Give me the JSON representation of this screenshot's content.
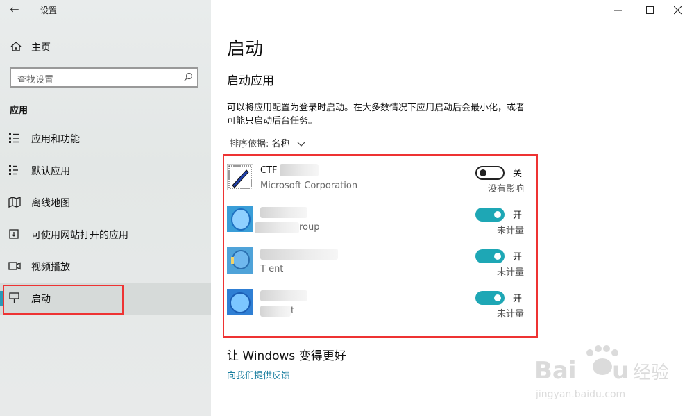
{
  "window": {
    "title": "设置",
    "back_icon": "back-arrow-icon",
    "controls": [
      "minimize-icon",
      "maximize-icon",
      "close-icon"
    ]
  },
  "sidebar": {
    "home_label": "主页",
    "search_placeholder": "查找设置",
    "section_label": "应用",
    "items": [
      {
        "label": "应用和功能",
        "icon": "apps-features-icon"
      },
      {
        "label": "默认应用",
        "icon": "default-apps-icon"
      },
      {
        "label": "离线地图",
        "icon": "offline-maps-icon"
      },
      {
        "label": "可使用网站打开的应用",
        "icon": "apps-for-websites-icon"
      },
      {
        "label": "视频播放",
        "icon": "video-playback-icon"
      },
      {
        "label": "启动",
        "icon": "startup-icon",
        "selected": true
      }
    ]
  },
  "main": {
    "title": "启动",
    "subtitle": "启动应用",
    "description": "可以将应用配置为登录时启动。在大多数情况下应用启动后会最小化，或者可能只启动后台任务。",
    "sort": {
      "label": "排序依据:",
      "value": "名称"
    },
    "apps": [
      {
        "name": "CTF",
        "publisher": "Microsoft Corporation",
        "state": "关",
        "on": false,
        "impact": "没有影响"
      },
      {
        "name": "",
        "publisher": "roup",
        "state": "开",
        "on": true,
        "impact": "未计量"
      },
      {
        "name": "",
        "publisher": "T     ent",
        "state": "开",
        "on": true,
        "impact": "未计量"
      },
      {
        "name": "",
        "publisher": "t",
        "state": "开",
        "on": true,
        "impact": "未计量"
      }
    ],
    "better_title": "让 Windows 变得更好",
    "feedback_link": "向我们提供反馈"
  },
  "colors": {
    "accent": "#1ea7b5",
    "highlight": "#e33333",
    "link": "#1a7fa0"
  },
  "watermark": {
    "brand": "Baidu经验",
    "url": "jingyan.baidu.com"
  }
}
